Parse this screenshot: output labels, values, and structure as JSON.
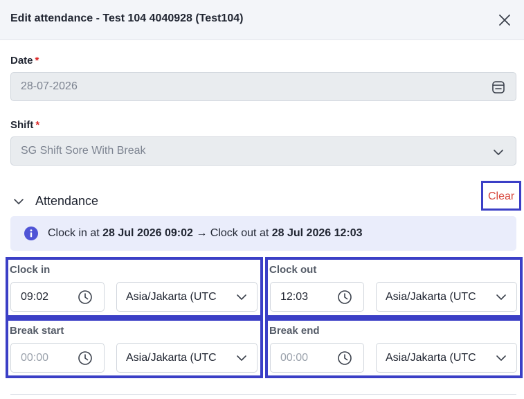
{
  "header": {
    "title": "Edit attendance - Test 104 4040928 (Test104)"
  },
  "form": {
    "date": {
      "label": "Date",
      "required": "*",
      "value": "28-07-2026"
    },
    "shift": {
      "label": "Shift",
      "required": "*",
      "value": "SG Shift Sore With Break"
    }
  },
  "attendance": {
    "section_title": "Attendance",
    "clear_label": "Clear",
    "info": {
      "prefix": "Clock in at ",
      "clock_in_datetime": "28 Jul 2026 09:02",
      "middle": " → Clock out at ",
      "clock_out_datetime": "28 Jul 2026 12:03"
    },
    "clock_in": {
      "label": "Clock in",
      "time": "09:02",
      "timezone": "Asia/Jakarta (UTC"
    },
    "clock_out": {
      "label": "Clock out",
      "time": "12:03",
      "timezone": "Asia/Jakarta (UTC"
    },
    "break_start": {
      "label": "Break start",
      "placeholder": "00:00",
      "timezone": "Asia/Jakarta (UTC"
    },
    "break_end": {
      "label": "Break end",
      "placeholder": "00:00",
      "timezone": "Asia/Jakarta (UTC"
    }
  },
  "colors": {
    "accent": "#3b3fc6",
    "danger": "#d6453a",
    "info_bg": "#eaedfb",
    "info_icon": "#4f54d6"
  },
  "icons": [
    "close-icon",
    "calendar-icon",
    "chevron-down-icon",
    "info-icon",
    "clock-icon"
  ]
}
